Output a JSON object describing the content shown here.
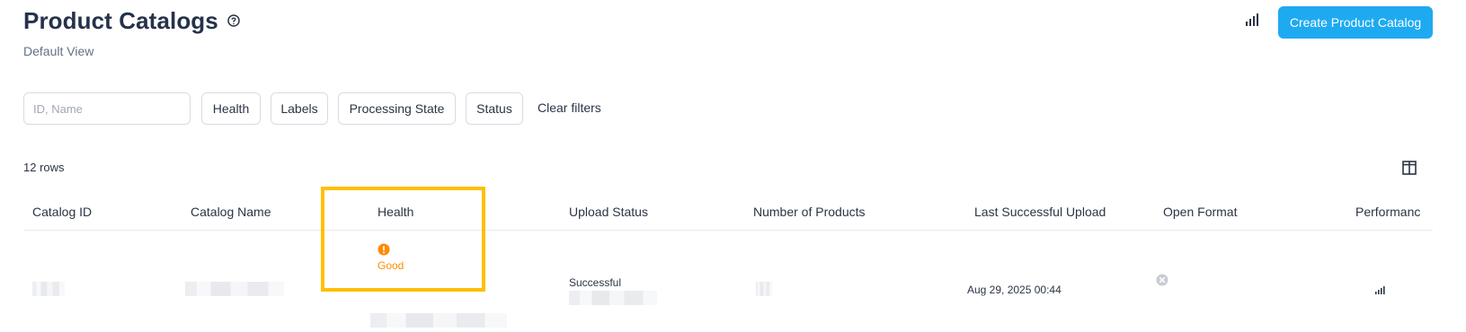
{
  "header": {
    "title": "Product Catalogs",
    "help_icon": "question-circle-icon",
    "subtitle": "Default View",
    "insights_icon": "signal-bars-icon",
    "create_button_label": "Create Product Catalog"
  },
  "filters": {
    "search_placeholder": "ID, Name",
    "search_value": "",
    "health_label": "Health",
    "labels_label": "Labels",
    "processing_state_label": "Processing State",
    "status_label": "Status",
    "clear_filters_label": "Clear filters"
  },
  "table": {
    "rows_count": "12 rows",
    "columns_icon": "columns-layout-icon",
    "headers": [
      "Catalog ID",
      "Catalog Name",
      "Health",
      "Upload Status",
      "Number of Products",
      "Last Successful Upload",
      "Open Format",
      "Performanc"
    ],
    "row": {
      "health_icon": "warning-circle-icon",
      "health_text": "Good",
      "upload_status": "Successful",
      "last_successful_upload": "Aug 29, 2025 00:44",
      "open_format_icon": "close-circle-icon",
      "performance_icon": "signal-bars-icon"
    }
  },
  "colors": {
    "accent": "#1eaaf1",
    "health_warning": "#ff8b00",
    "highlight_border": "#ffbf00",
    "text": "#2b3445"
  }
}
